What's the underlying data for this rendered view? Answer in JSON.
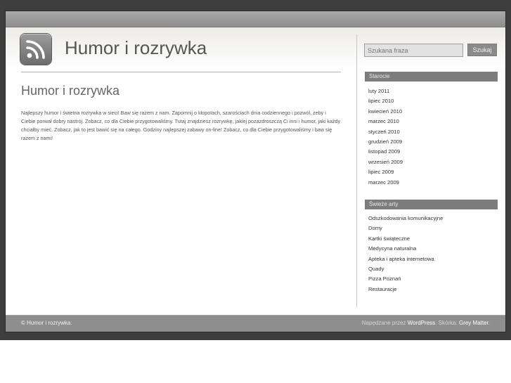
{
  "header": {
    "site_title": "Humor i rozrywka",
    "logo_icon": "rss-icon"
  },
  "search": {
    "placeholder": "Szukana fraza",
    "button_label": "Szukaj"
  },
  "post": {
    "title": "Humor i rozrywka",
    "body": "Najlepszy humor i świetna rozrywka w sieci! Baw się razem z nam. Zapomnij o kłopotach, szarościach dnia codziennego i pozwól, żeby i Ciebie porwał dobry nastrój. Zobacz, co dla Ciebie przygotowaliśmy. Tutaj znajdziesz rozrywkę, jakiej pozazdroszczą Ci inni i humor, jaki każdy chciałby mieć. Zobacz, jak to jest bawić się na całego. Godziny najlepszej zabawy on-line! Zobacz, co dla Ciebie przygotowaliśmy i baw się razem z nami!"
  },
  "sidebar": {
    "archives": {
      "heading": "Starocie",
      "items": [
        "luty 2011",
        "lipiec 2010",
        "kwiecień 2010",
        "marzec 2010",
        "styczeń 2010",
        "grudzień 2009",
        "listopad 2009",
        "wrzesień 2009",
        "lipiec 2009",
        "marzec 2009"
      ]
    },
    "recent": {
      "heading": "Świeże arty",
      "items": [
        "Odszkodowania komunikacyjne",
        "Domy",
        "Kartki świąteczne",
        "Medycyna naturalna",
        "Apteka i apteka internetowa",
        "Quady",
        "Pizza Poznań",
        "Restauracje"
      ]
    }
  },
  "footer": {
    "copyright": "© Humor i rozrywka.",
    "powered_prefix": "Napędzane przez",
    "powered_link": "WordPress",
    "theme_prefix": ". Skórka:",
    "theme_link": "Grey Matter",
    "suffix": "."
  },
  "colors": {
    "frame": "#3e3e3e",
    "topbar": "#9a9a9a",
    "widget_heading": "#7c7c7c",
    "footer": "#8e8e8e"
  }
}
